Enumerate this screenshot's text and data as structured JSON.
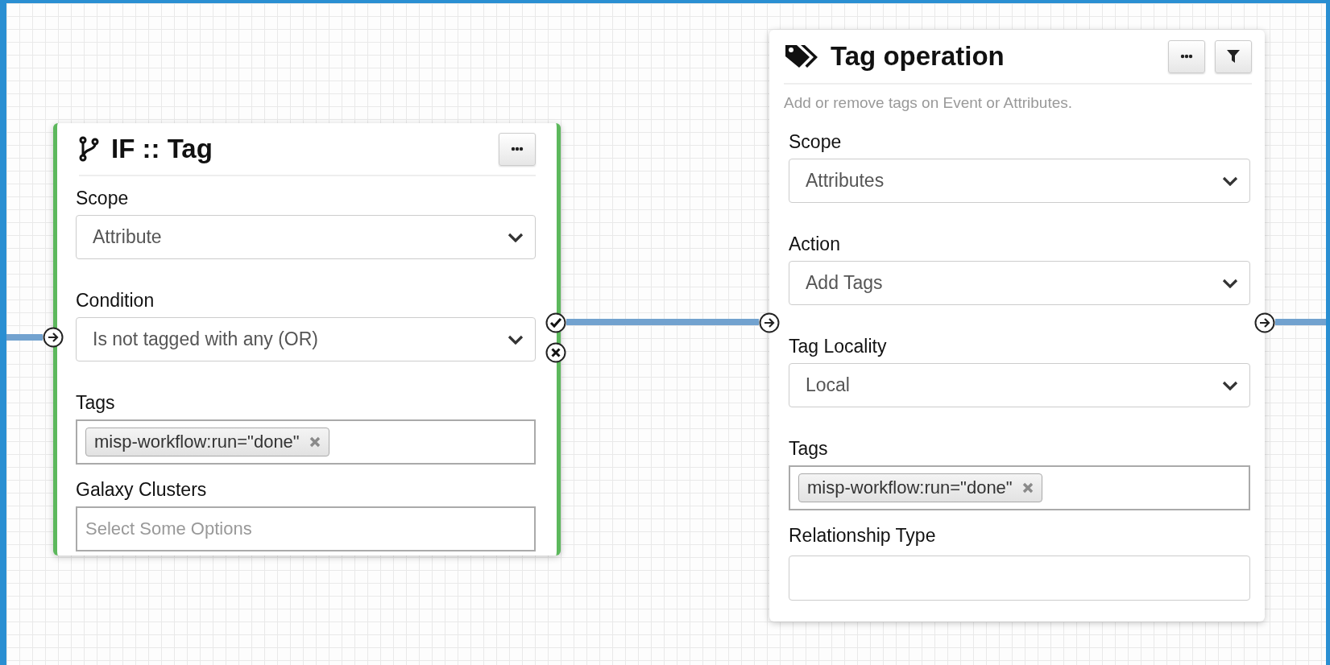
{
  "nodes": [
    {
      "kind": "condition",
      "title": "IF :: Tag",
      "buttons": [
        {
          "kind": "more"
        }
      ],
      "fields": [
        {
          "label": "Scope",
          "kind": "select",
          "value": "Attribute"
        },
        {
          "label": "Condition",
          "kind": "select",
          "value": "Is not tagged with any (OR)"
        },
        {
          "label": "Tags",
          "kind": "tags",
          "tags": [
            "misp-workflow:run=\"done\""
          ]
        },
        {
          "label": "Galaxy Clusters",
          "kind": "tags",
          "placeholder": "Select Some Options"
        }
      ],
      "ports": [
        {
          "kind": "input"
        },
        {
          "kind": "success"
        },
        {
          "kind": "failure"
        }
      ]
    },
    {
      "kind": "action",
      "title": "Tag operation",
      "description": "Add or remove tags on Event or Attributes.",
      "buttons": [
        {
          "kind": "more"
        },
        {
          "kind": "filter"
        }
      ],
      "fields": [
        {
          "label": "Scope",
          "kind": "select",
          "value": "Attributes"
        },
        {
          "label": "Action",
          "kind": "select",
          "value": "Add Tags"
        },
        {
          "label": "Tag Locality",
          "kind": "select",
          "value": "Local"
        },
        {
          "label": "Tags",
          "kind": "tags",
          "tags": [
            "misp-workflow:run=\"done\""
          ]
        },
        {
          "label": "Relationship Type",
          "kind": "text"
        }
      ],
      "ports": [
        {
          "kind": "input"
        },
        {
          "kind": "output"
        }
      ]
    }
  ]
}
